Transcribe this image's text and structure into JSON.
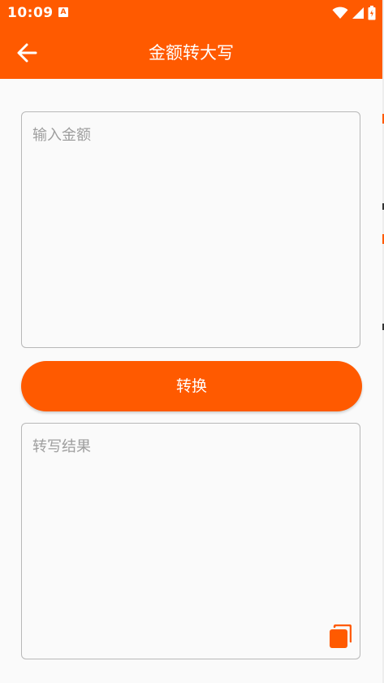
{
  "status_bar": {
    "time": "10:09",
    "notification_badge": "A"
  },
  "toolbar": {
    "title": "金额转大写"
  },
  "amount_input": {
    "placeholder": "输入金额",
    "value": ""
  },
  "convert_button": {
    "label": "转换"
  },
  "result": {
    "placeholder": "转写结果",
    "value": ""
  },
  "colors": {
    "accent": "#ff5a00",
    "background": "#fafafa",
    "border": "#b8b8b8",
    "placeholder": "#9e9e9e"
  },
  "icons": {
    "back": "arrow-left-icon",
    "copy": "copy-icon",
    "wifi": "wifi-icon",
    "signal": "signal-icon",
    "battery": "battery-icon"
  }
}
